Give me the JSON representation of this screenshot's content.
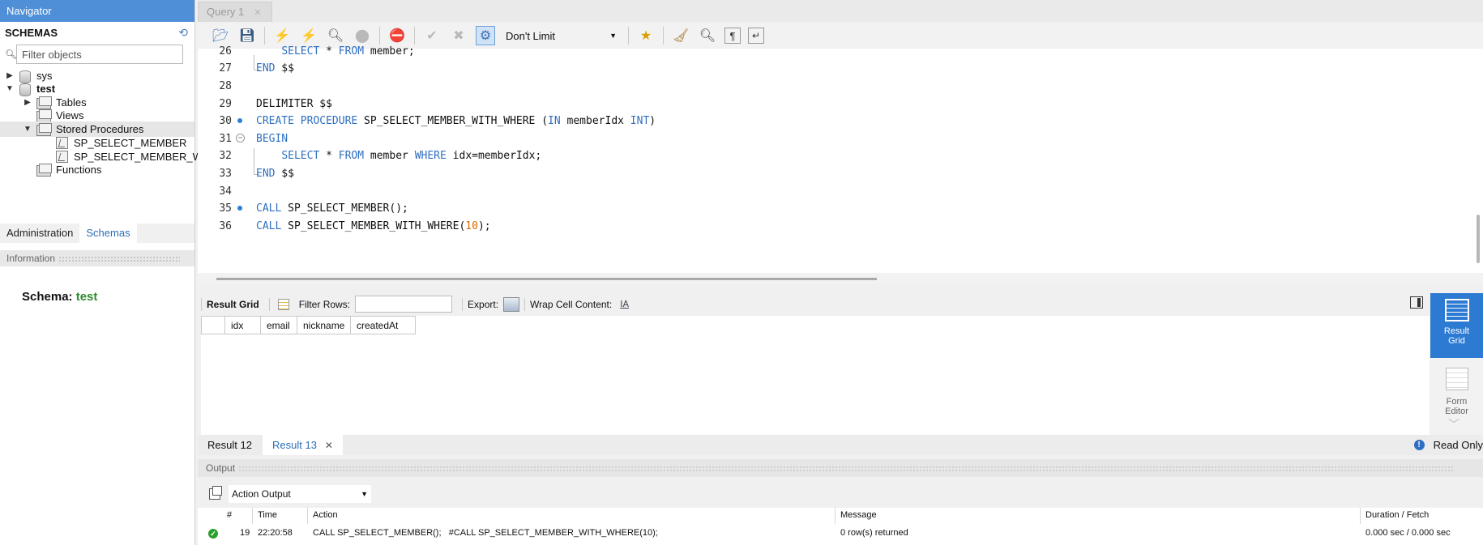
{
  "navigator": {
    "title": "Navigator",
    "schemas_label": "SCHEMAS",
    "filter_placeholder": "Filter objects",
    "tree": {
      "sys": "sys",
      "test": "test",
      "tables": "Tables",
      "views": "Views",
      "stored_procedures": "Stored Procedures",
      "proc1": "SP_SELECT_MEMBER",
      "proc2": "SP_SELECT_MEMBER_W",
      "functions": "Functions"
    },
    "tabs": {
      "administration": "Administration",
      "schemas": "Schemas"
    },
    "info_label": "Information",
    "schema_info": {
      "label": "Schema:",
      "value": "test"
    }
  },
  "editor": {
    "tab_title": "Query 1",
    "limit": "Don't Limit",
    "lines": [
      {
        "num": "26",
        "a": "SELECT",
        "b": " * ",
        "c": "FROM",
        "d": " member;"
      },
      {
        "num": "27",
        "a": "END",
        "b": " $$"
      },
      {
        "num": "28"
      },
      {
        "num": "29",
        "a": "DELIMITER $$"
      },
      {
        "num": "30",
        "a": "CREATE PROCEDURE",
        "b": " SP_SELECT_MEMBER_WITH_WHERE (",
        "c": "IN",
        "d": " memberIdx ",
        "e": "INT",
        "f": ")"
      },
      {
        "num": "31",
        "a": "BEGIN"
      },
      {
        "num": "32",
        "a": "SELECT",
        "b": " * ",
        "c": "FROM",
        "d": " member ",
        "e": "WHERE",
        "f": " idx=memberIdx;"
      },
      {
        "num": "33",
        "a": "END",
        "b": " $$"
      },
      {
        "num": "34"
      },
      {
        "num": "35",
        "a": "CALL",
        "b": " SP_SELECT_MEMBER();"
      },
      {
        "num": "36",
        "a": "CALL",
        "b": " SP_SELECT_MEMBER_WITH_WHERE(",
        "c": "10",
        "d": ");"
      }
    ]
  },
  "result": {
    "grid_label": "Result Grid",
    "filter_rows_label": "Filter Rows:",
    "export_label": "Export:",
    "wrap_label": "Wrap Cell Content:",
    "wrap_icon_text": "IA",
    "columns": [
      "idx",
      "email",
      "nickname",
      "createdAt"
    ],
    "side_result_grid": "Result Grid",
    "side_form_editor": "Form Editor",
    "tabs": [
      "Result 12",
      "Result 13"
    ],
    "read_only": "Read Only"
  },
  "output": {
    "title": "Output",
    "selector": "Action Output",
    "columns": {
      "num": "#",
      "time": "Time",
      "action": "Action",
      "message": "Message",
      "duration": "Duration / Fetch"
    },
    "row": {
      "num": "19",
      "time": "22:20:58",
      "action": "CALL SP_SELECT_MEMBER();   #CALL SP_SELECT_MEMBER_WITH_WHERE(10);",
      "message": "0 row(s) returned",
      "duration": "0.000 sec / 0.000 sec"
    }
  },
  "colors": {
    "accent": "#2d7ad2",
    "keyword": "#2f6fc0",
    "number": "#d66c00",
    "success": "#2ca02c"
  }
}
